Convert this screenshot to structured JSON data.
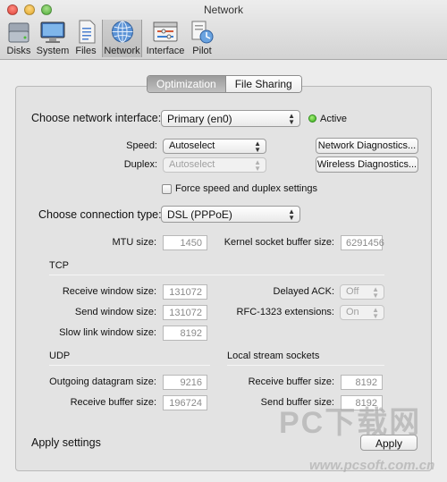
{
  "window": {
    "title": "Network"
  },
  "toolbar": {
    "items": [
      {
        "label": "Disks"
      },
      {
        "label": "System"
      },
      {
        "label": "Files"
      },
      {
        "label": "Network"
      },
      {
        "label": "Interface"
      },
      {
        "label": "Pilot"
      }
    ],
    "selected": "Network"
  },
  "tabs": {
    "optimization": "Optimization",
    "file_sharing": "File Sharing",
    "selected": "Optimization"
  },
  "interface": {
    "label": "Choose network interface:",
    "value": "Primary (en0)",
    "status": "Active",
    "status_color": "#35a817"
  },
  "speed": {
    "label": "Speed:",
    "value": "Autoselect"
  },
  "duplex": {
    "label": "Duplex:",
    "value": "Autoselect"
  },
  "buttons": {
    "diagnostics": "Network Diagnostics...",
    "wireless": "Wireless Diagnostics...",
    "apply": "Apply"
  },
  "force": {
    "label": "Force speed and duplex settings",
    "checked": false
  },
  "connection": {
    "label": "Choose connection type:",
    "value": "DSL (PPPoE)"
  },
  "mtu": {
    "label": "MTU size:",
    "value": "1450"
  },
  "kernel": {
    "label": "Kernel socket buffer size:",
    "value": "6291456"
  },
  "tcp": {
    "heading": "TCP",
    "receive_window": {
      "label": "Receive window size:",
      "value": "131072"
    },
    "send_window": {
      "label": "Send window size:",
      "value": "131072"
    },
    "slow_link": {
      "label": "Slow link window size:",
      "value": "8192"
    },
    "delayed_ack": {
      "label": "Delayed ACK:",
      "value": "Off"
    },
    "rfc1323": {
      "label": "RFC-1323 extensions:",
      "value": "On"
    }
  },
  "udp": {
    "heading": "UDP",
    "datagram": {
      "label": "Outgoing datagram size:",
      "value": "9216"
    },
    "receive_buffer": {
      "label": "Receive buffer size:",
      "value": "196724"
    }
  },
  "local": {
    "heading": "Local stream sockets",
    "receive_buffer": {
      "label": "Receive buffer size:",
      "value": "8192"
    },
    "send_buffer": {
      "label": "Send buffer size:",
      "value": "8192"
    }
  },
  "footer": {
    "label": "Apply settings"
  },
  "watermark": {
    "line1": "PC下载网",
    "line2": "www.pcsoft.com.cn"
  }
}
